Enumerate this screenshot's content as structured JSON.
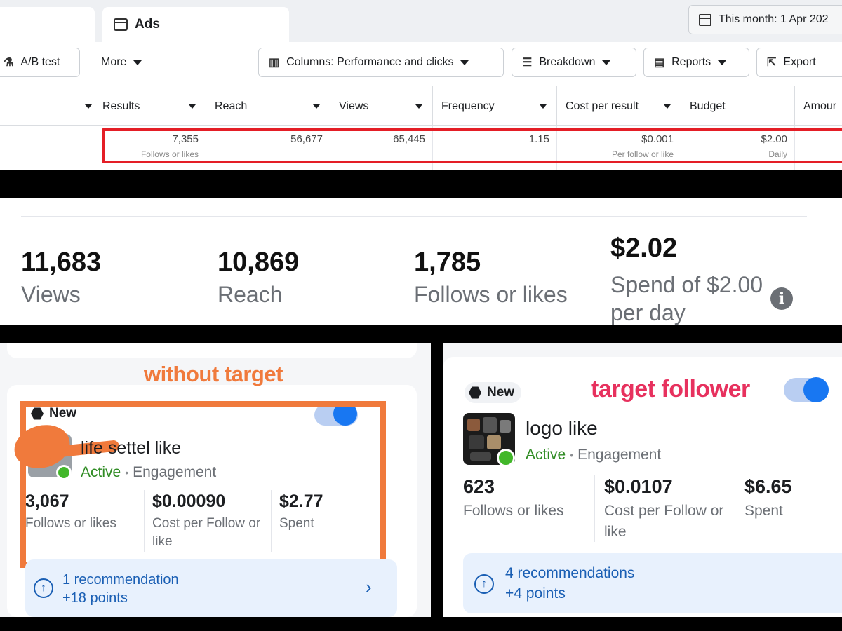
{
  "ads_table": {
    "tab_label": "Ads",
    "date_range": "This month: 1 Apr 202",
    "toolbar": {
      "ab_test": "A/B test",
      "more": "More",
      "columns": "Columns: Performance and clicks",
      "breakdown": "Breakdown",
      "reports": "Reports",
      "export": "Export"
    },
    "columns": [
      "Results",
      "Reach",
      "Views",
      "Frequency",
      "Cost per result",
      "Budget",
      "Amour"
    ],
    "row": {
      "results": "7,355",
      "results_sub": "Follows or likes",
      "reach": "56,677",
      "views": "65,445",
      "frequency": "1.15",
      "cost_per_result": "$0.001",
      "cost_sub": "Per follow or like",
      "budget": "$2.00",
      "budget_sub": "Daily"
    }
  },
  "summary": {
    "views_value": "11,683",
    "views_label": "Views",
    "reach_value": "10,869",
    "reach_label": "Reach",
    "follows_value": "1,785",
    "follows_label": "Follows or likes",
    "spend_value": "$2.02",
    "spend_label": "Spend of $2.00 per day"
  },
  "without_target": {
    "annotation": "without target",
    "badge": "New",
    "title": "life settel like",
    "status": "Active",
    "type": "Engagement",
    "stats": [
      {
        "value": "3,067",
        "label": "Follows or likes"
      },
      {
        "value": "$0.00090",
        "label": "Cost per Follow or like"
      },
      {
        "value": "$2.77",
        "label": "Spent"
      }
    ],
    "recommendation": "1 recommendation",
    "points": "+18 points"
  },
  "target_follower": {
    "annotation": "target follower",
    "badge": "New",
    "title": "logo like",
    "status": "Active",
    "type": "Engagement",
    "stats": [
      {
        "value": "623",
        "label": "Follows or likes"
      },
      {
        "value": "$0.0107",
        "label": "Cost per Follow or like"
      },
      {
        "value": "$6.65",
        "label": "Spent"
      }
    ],
    "recommendation": "4 recommendations",
    "points": "+4 points"
  },
  "colors": {
    "annotation_orange": "#f07a3c",
    "annotation_pink": "#e7315e",
    "highlight_red": "#e41e26",
    "active_green": "#2e8b22",
    "link_blue": "#1a5fb4"
  }
}
